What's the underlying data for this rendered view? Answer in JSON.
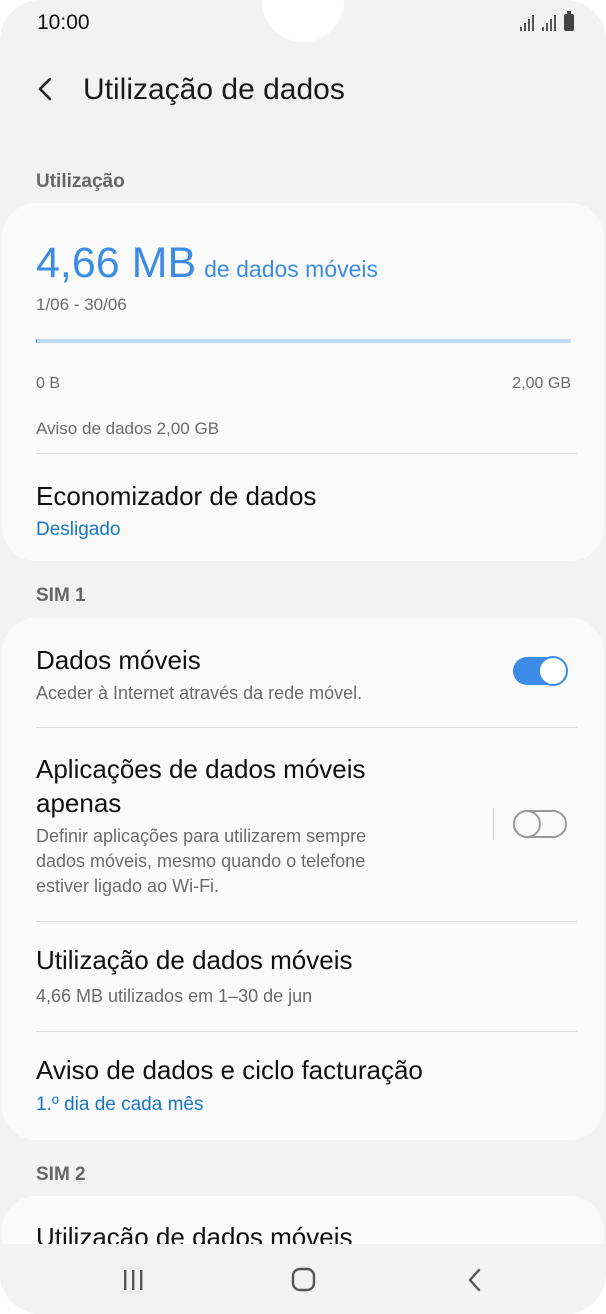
{
  "status_bar": {
    "time": "10:00"
  },
  "header": {
    "title": "Utilização de dados"
  },
  "usage_section": {
    "label": "Utilização",
    "amount": "4,66 MB",
    "amount_suffix": "de dados móveis",
    "period": "1/06 - 30/06",
    "usage_fraction": 0.002,
    "bar_min": "0 B",
    "bar_max": "2,00 GB",
    "warning": "Aviso de dados 2,00 GB",
    "saver_title": "Economizador de dados",
    "saver_status": "Desligado"
  },
  "sim1": {
    "label": "SIM 1",
    "mobile_data": {
      "title": "Dados móveis",
      "subtitle": "Aceder à Internet através da rede móvel.",
      "enabled": true
    },
    "mobile_only_apps": {
      "title_line1": "Aplicações de dados móveis",
      "title_line2": "apenas",
      "subtitle_line1": "Definir aplicações para utilizarem sempre",
      "subtitle_line2": "dados móveis, mesmo quando o telefone",
      "subtitle_line3": "estiver ligado ao Wi-Fi.",
      "enabled": false
    },
    "usage": {
      "title": "Utilização de dados móveis",
      "subtitle": "4,66 MB utilizados em 1–30 de jun"
    },
    "billing": {
      "title": "Aviso de dados e ciclo facturação",
      "subtitle": "1.º dia de cada mês"
    }
  },
  "sim2": {
    "label": "SIM 2",
    "usage_title": "Utilização de dados móveis"
  },
  "colors": {
    "accent": "#3c8ce7",
    "link": "#1677c8",
    "background": "#f2f2f2",
    "card": "#fafafa"
  },
  "icons": {
    "back": "back-arrow-icon",
    "recents": "recents-icon",
    "home": "home-icon",
    "nav_back": "nav-back-icon"
  }
}
